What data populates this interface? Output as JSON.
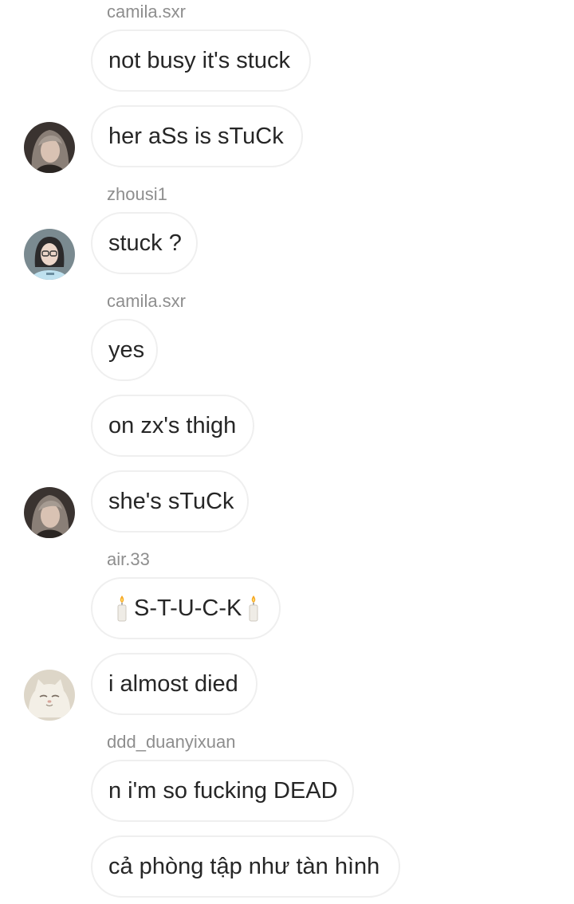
{
  "messages": [
    {
      "sender": "camila.sxr",
      "text": "not busy it's stuck"
    },
    {
      "text": "her aSs is sTuCk"
    },
    {
      "sender": "zhousi1",
      "text": "stuck ?"
    },
    {
      "sender": "camila.sxr",
      "text": "yes"
    },
    {
      "text": "on zx's thigh"
    },
    {
      "text": "she's sTuCk"
    },
    {
      "sender": "air.33",
      "text": "S-T-U-C-K",
      "emoji": "candle"
    },
    {
      "text": "i almost died"
    },
    {
      "sender": "ddd_duanyixuan",
      "text": "n i'm so fucking DEAD"
    },
    {
      "text": "cả phòng tập như tàn hình"
    }
  ],
  "avatars": [
    "avatar-girl-long-hair",
    "avatar-girl-glasses",
    "avatar-girl-long-hair",
    "avatar-white-cat"
  ]
}
